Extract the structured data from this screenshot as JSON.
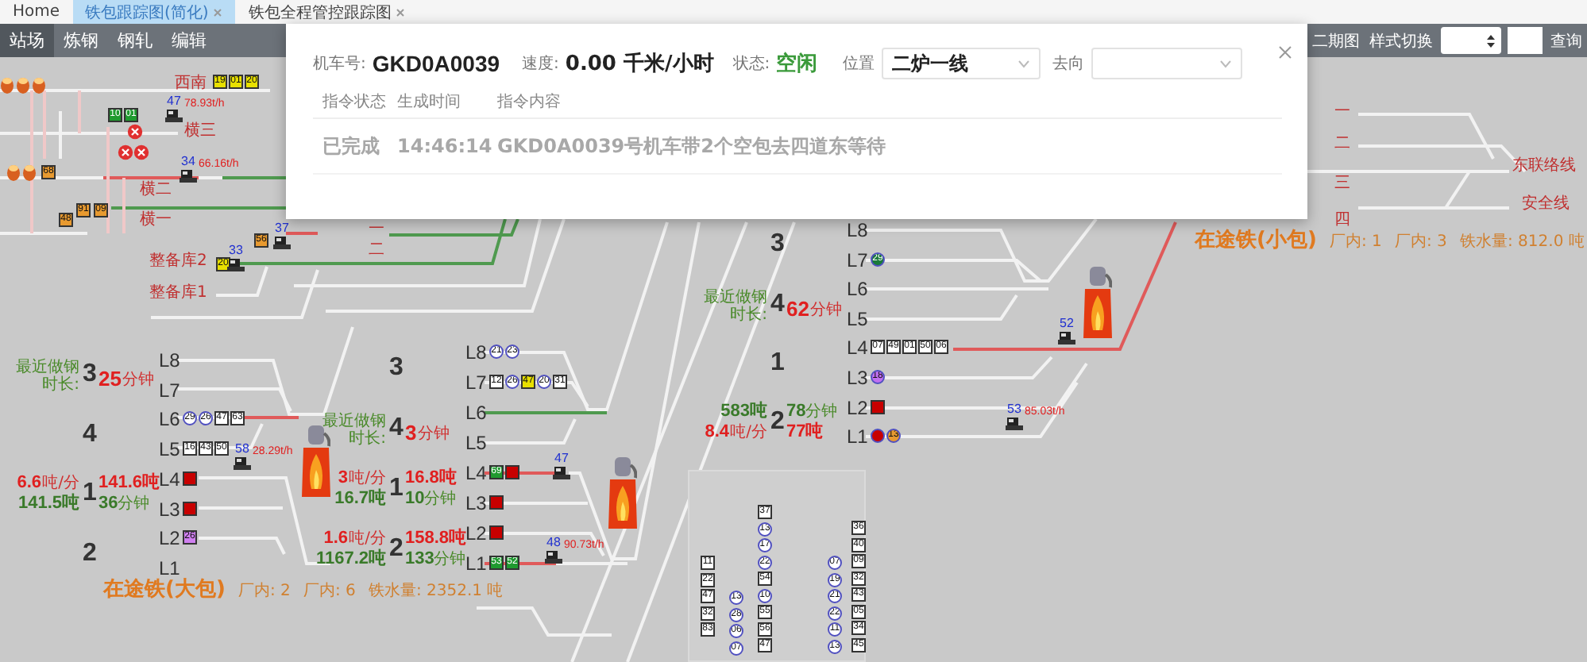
{
  "tabs": [
    {
      "label": "Home",
      "selected": false,
      "closable": false
    },
    {
      "label": "铁包跟踪图(简化)",
      "selected": true,
      "closable": true
    },
    {
      "label": "铁包全程管控跟踪图",
      "selected": false,
      "closable": true
    }
  ],
  "nav": {
    "items": [
      {
        "label": "站场",
        "selected": true
      },
      {
        "label": "炼钢",
        "selected": false
      },
      {
        "label": "钢轧",
        "selected": false
      },
      {
        "label": "编辑",
        "selected": false
      }
    ],
    "right_items": [
      "二期图",
      "样式切换"
    ],
    "query_button": "查询"
  },
  "dialog": {
    "loco_label": "机车号:",
    "loco": "GKD0A0039",
    "speed_label": "速度:",
    "speed": "0.00 千米/小时",
    "status_label": "状态:",
    "status": "空闲",
    "position_label": "位置",
    "position": "二炉一线",
    "direction_label": "去向",
    "columns": [
      "指令状态",
      "生成时间",
      "指令内容"
    ],
    "rows": [
      [
        "已完成",
        "14:46:14",
        "GKD0A0039号机车带2个空包去四道东等待"
      ]
    ]
  },
  "yard": {
    "labels": [
      "西南",
      "横三",
      "横二",
      "横一",
      "整备库2",
      "整备库1",
      "一",
      "二"
    ],
    "cars": [
      {
        "number": "19",
        "kind": "square",
        "color": "#e8e000"
      },
      {
        "number": "01",
        "kind": "square",
        "color": "#e8e000"
      },
      {
        "number": "20",
        "kind": "square",
        "color": "#e8e000"
      },
      {
        "number": "10",
        "kind": "square",
        "color": "#1f9a2f"
      },
      {
        "number": "01",
        "kind": "square",
        "color": "#1f9a2f"
      },
      {
        "number": "68",
        "kind": "square",
        "color": "#e89a30"
      },
      {
        "number": "48",
        "kind": "square",
        "color": "#e89a30"
      },
      {
        "number": "91",
        "kind": "square",
        "color": "#e89a30"
      },
      {
        "number": "09",
        "kind": "square",
        "color": "#e89a30"
      },
      {
        "number": "56",
        "kind": "square",
        "color": "#e89a30"
      },
      {
        "number": "20",
        "kind": "square",
        "color": "#e8e000"
      }
    ]
  },
  "east_yard": {
    "labels": [
      "一",
      "二",
      "三",
      "四",
      "东联络线",
      "安全线"
    ]
  },
  "locomotives": [
    {
      "number": "47",
      "reading": "78.93t/h"
    },
    {
      "number": "34",
      "reading": "66.16t/h"
    },
    {
      "number": "37"
    },
    {
      "number": "33"
    },
    {
      "number": "58",
      "reading": "28.29t/h"
    },
    {
      "number": "47"
    },
    {
      "number": "48",
      "reading": "90.73t/h"
    },
    {
      "number": "52"
    },
    {
      "number": "53",
      "reading": "85.03t/h"
    }
  ],
  "converters": [
    {
      "lines": [
        {
          "label": "L8"
        },
        {
          "label": "L7"
        },
        {
          "label": "L6",
          "cars": [
            {
              "number": "29",
              "kind": "circle",
              "color": "#ffffff"
            },
            {
              "number": "26",
              "kind": "circle",
              "color": "#ffffff"
            },
            {
              "number": "47",
              "kind": "square",
              "color": "#ffffff"
            },
            {
              "number": "63",
              "kind": "square",
              "color": "#ffffff"
            }
          ]
        },
        {
          "label": "L5",
          "cars": [
            {
              "number": "16",
              "kind": "square",
              "color": "#ffffff"
            },
            {
              "number": "43",
              "kind": "square",
              "color": "#ffffff"
            },
            {
              "number": "50",
              "kind": "square",
              "color": "#ffffff"
            }
          ]
        },
        {
          "label": "L4",
          "cars": [
            {
              "kind": "square",
              "color": "#c80000"
            }
          ]
        },
        {
          "label": "L3",
          "cars": [
            {
              "kind": "square",
              "color": "#c80000"
            }
          ]
        },
        {
          "label": "L2",
          "cars": [
            {
              "number": "26",
              "kind": "square",
              "color": "#d080f0"
            }
          ]
        },
        {
          "label": "L1"
        }
      ],
      "groups": [
        {
          "number": "3",
          "wait": {
            "label": "最近做钢时长:",
            "value": "25",
            "unit": "分钟"
          }
        },
        {
          "number": "4"
        },
        {
          "number": "1",
          "stats": {
            "kind": "rate-first",
            "rate": "6.6",
            "rate_unit": "吨/分",
            "weight": "141.6吨",
            "total": "141.5吨",
            "time": "36",
            "time_unit": "分钟"
          }
        },
        {
          "number": "2"
        }
      ],
      "transit": {
        "title": "在途铁(大包)",
        "inside_a": "厂内: 2",
        "inside_b": "厂内: 6",
        "amount": "铁水量: 2352.1 吨"
      }
    },
    {
      "lines": [
        {
          "label": "L8",
          "cars": [
            {
              "number": "21",
              "kind": "circle",
              "color": "#ffffff"
            },
            {
              "number": "23",
              "kind": "circle",
              "color": "#ffffff"
            }
          ]
        },
        {
          "label": "L7",
          "cars": [
            {
              "number": "12",
              "kind": "square",
              "color": "#ffffff"
            },
            {
              "number": "26",
              "kind": "circle",
              "color": "#ffffff"
            },
            {
              "number": "47",
              "kind": "square",
              "color": "#e8e000"
            },
            {
              "number": "20",
              "kind": "circle",
              "color": "#ffffff"
            },
            {
              "number": "31",
              "kind": "square",
              "color": "#ffffff"
            }
          ]
        },
        {
          "label": "L6"
        },
        {
          "label": "L5"
        },
        {
          "label": "L4",
          "cars": [
            {
              "number": "69",
              "kind": "square",
              "color": "#1f9a2f"
            },
            {
              "kind": "square",
              "color": "#c80000"
            }
          ]
        },
        {
          "label": "L3",
          "cars": [
            {
              "kind": "square",
              "color": "#c80000"
            }
          ]
        },
        {
          "label": "L2",
          "cars": [
            {
              "kind": "square",
              "color": "#c80000"
            }
          ]
        },
        {
          "label": "L1",
          "cars": [
            {
              "number": "53",
              "kind": "square",
              "color": "#1f9a2f"
            },
            {
              "number": "52",
              "kind": "square",
              "color": "#1f9a2f"
            }
          ]
        }
      ],
      "groups": [
        {
          "number": "3"
        },
        {
          "number": "4",
          "wait": {
            "label": "最近做钢时长:",
            "value": "3",
            "unit": "分钟"
          }
        },
        {
          "number": "1",
          "stats": {
            "kind": "rate-first",
            "rate": "3",
            "rate_unit": "吨/分",
            "weight": "16.8吨",
            "total": "16.7吨",
            "time": "10",
            "time_unit": "分钟"
          }
        },
        {
          "number": "2",
          "stats": {
            "kind": "rate-first",
            "rate": "1.6",
            "rate_unit": "吨/分",
            "weight": "158.8吨",
            "total": "1167.2吨",
            "time": "133",
            "time_unit": "分钟"
          }
        }
      ]
    },
    {
      "lines": [
        {
          "label": "L8"
        },
        {
          "label": "L7",
          "cars": [
            {
              "number": "29",
              "kind": "circle",
              "color": "#1a7a3a"
            }
          ]
        },
        {
          "label": "L6"
        },
        {
          "label": "L5"
        },
        {
          "label": "L4",
          "cars": [
            {
              "number": "07",
              "kind": "square",
              "color": "#ffffff"
            },
            {
              "number": "49",
              "kind": "square",
              "color": "#ffffff"
            },
            {
              "number": "01",
              "kind": "square",
              "color": "#ffffff"
            },
            {
              "number": "50",
              "kind": "square",
              "color": "#ffffff"
            },
            {
              "number": "06",
              "kind": "square",
              "color": "#ffffff"
            }
          ]
        },
        {
          "label": "L3",
          "cars": [
            {
              "number": "18",
              "kind": "circle",
              "color": "#c070f0"
            }
          ]
        },
        {
          "label": "L2",
          "cars": [
            {
              "kind": "square",
              "color": "#c80000"
            }
          ]
        },
        {
          "label": "L1",
          "cars": [
            {
              "kind": "circle",
              "color": "#c80000"
            },
            {
              "number": "13",
              "kind": "circle",
              "color": "#e89a30"
            }
          ]
        }
      ],
      "groups": [
        {
          "number": "3"
        },
        {
          "number": "4",
          "wait": {
            "label": "最近做钢时长:",
            "value": "62",
            "unit": "分钟"
          }
        },
        {
          "number": "1"
        },
        {
          "number": "2",
          "stats": {
            "kind": "total-first",
            "rate": "8.4",
            "rate_unit": "吨/分",
            "weight": "77吨",
            "total": "583吨",
            "time": "78",
            "time_unit": "分钟"
          }
        }
      ],
      "transit": {
        "title": "在途铁(小包)",
        "inside_a": "厂内: 1",
        "inside_b": "厂内: 3",
        "amount": "铁水量: 812.0 吨"
      }
    }
  ],
  "queue_panel": {
    "columns": [
      [
        {
          "number": "11",
          "kind": "square",
          "color": "#ffffff"
        },
        {
          "number": "22",
          "kind": "square",
          "color": "#ffffff"
        },
        {
          "number": "47",
          "kind": "square",
          "color": "#ffffff"
        },
        {
          "number": "32",
          "kind": "square",
          "color": "#ffffff"
        },
        {
          "number": "83",
          "kind": "square",
          "color": "#ffffff"
        }
      ],
      [
        {
          "number": "13",
          "kind": "circle",
          "color": "#ffffff"
        },
        {
          "number": "28",
          "kind": "circle",
          "color": "#ffffff"
        },
        {
          "number": "06",
          "kind": "circle",
          "color": "#ffffff"
        },
        {
          "number": "07",
          "kind": "circle",
          "color": "#ffffff"
        }
      ],
      [
        {
          "number": "37",
          "kind": "square",
          "color": "#ffffff"
        },
        {
          "number": "13",
          "kind": "circle",
          "color": "#ffffff"
        },
        {
          "number": "17",
          "kind": "circle",
          "color": "#ffffff"
        },
        {
          "number": "22",
          "kind": "circle",
          "color": "#ffffff"
        },
        {
          "number": "54",
          "kind": "square",
          "color": "#ffffff"
        },
        {
          "number": "10",
          "kind": "circle",
          "color": "#ffffff"
        },
        {
          "number": "55",
          "kind": "square",
          "color": "#ffffff"
        },
        {
          "number": "56",
          "kind": "square",
          "color": "#ffffff"
        },
        {
          "number": "47",
          "kind": "square",
          "color": "#ffffff"
        }
      ],
      [
        {
          "number": "07",
          "kind": "circle",
          "color": "#ffffff"
        },
        {
          "number": "19",
          "kind": "circle",
          "color": "#ffffff"
        },
        {
          "number": "21",
          "kind": "circle",
          "color": "#ffffff"
        },
        {
          "number": "22",
          "kind": "circle",
          "color": "#ffffff"
        },
        {
          "number": "11",
          "kind": "circle",
          "color": "#ffffff"
        },
        {
          "number": "13",
          "kind": "circle",
          "color": "#ffffff"
        }
      ],
      [
        {
          "number": "36",
          "kind": "square",
          "color": "#ffffff"
        },
        {
          "number": "40",
          "kind": "square",
          "color": "#ffffff"
        },
        {
          "number": "09",
          "kind": "square",
          "color": "#ffffff"
        },
        {
          "number": "32",
          "kind": "square",
          "color": "#ffffff"
        },
        {
          "number": "43",
          "kind": "square",
          "color": "#ffffff"
        },
        {
          "number": "05",
          "kind": "square",
          "color": "#ffffff"
        },
        {
          "number": "34",
          "kind": "square",
          "color": "#ffffff"
        },
        {
          "number": "45",
          "kind": "square",
          "color": "#ffffff"
        }
      ]
    ]
  }
}
